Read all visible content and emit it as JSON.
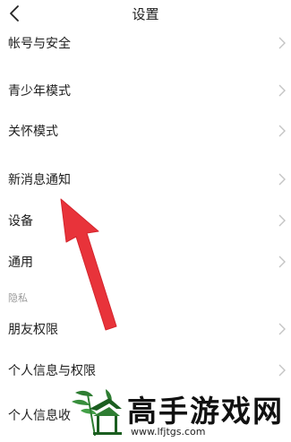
{
  "header": {
    "title": "设置",
    "back_icon": "chevron-left-icon"
  },
  "settings": {
    "items": [
      {
        "label": "帐号与安全"
      },
      {
        "label": "青少年模式"
      },
      {
        "label": "关怀模式"
      },
      {
        "label": "新消息通知"
      },
      {
        "label": "设备"
      },
      {
        "label": "通用"
      }
    ],
    "privacy_section": {
      "label": "隐私",
      "items": [
        {
          "label": "朋友权限"
        },
        {
          "label": "个人信息与权限"
        },
        {
          "label": "个人信息收"
        }
      ]
    },
    "chevron_icon": "chevron-right-icon"
  },
  "annotation": {
    "arrow_color": "#e8333a",
    "points_to": "新消息通知"
  },
  "watermark": {
    "title": "高手游戏网",
    "url": "www.lfjtgs.com",
    "logo_icon": "pavilion-logo-icon",
    "logo_color": "#2e7d32"
  }
}
